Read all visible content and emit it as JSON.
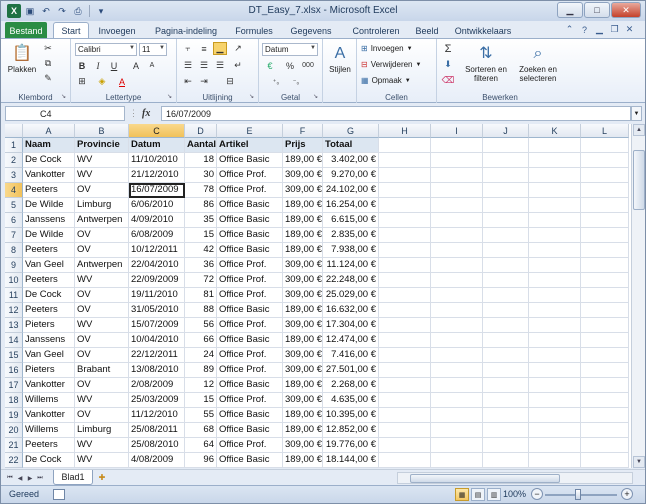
{
  "window": {
    "title": "DT_Easy_7.xlsx - Microsoft Excel",
    "app_icon": "X",
    "buttons": [
      "minimize",
      "maximize",
      "close"
    ]
  },
  "ribbon_tabs": [
    "Bestand",
    "Start",
    "Invoegen",
    "Pagina-indeling",
    "Formules",
    "Gegevens",
    "Controleren",
    "Beeld",
    "Ontwikkelaars"
  ],
  "ribbon": {
    "klembord": {
      "label": "Klembord",
      "plakken": "Plakken"
    },
    "lettertype": {
      "label": "Lettertype",
      "font": "Calibri",
      "size": "11"
    },
    "uitlijning": {
      "label": "Uitlijning"
    },
    "getal": {
      "label": "Getal",
      "format": "Datum"
    },
    "stijlen": {
      "label": "Stijlen"
    },
    "cellen": {
      "label": "Cellen",
      "invoegen": "Invoegen",
      "verwijderen": "Verwijderen",
      "opmaak": "Opmaak"
    },
    "bewerken": {
      "label": "Bewerken",
      "sorteren_1": "Sorteren en",
      "sorteren_2": "filteren",
      "zoeken_1": "Zoeken en",
      "zoeken_2": "selecteren"
    }
  },
  "formula_bar": {
    "name_box": "C4",
    "fx": "fx",
    "value": "16/07/2009"
  },
  "columns": [
    "A",
    "B",
    "C",
    "D",
    "E",
    "F",
    "G",
    "H",
    "I",
    "J",
    "K",
    "L"
  ],
  "selected_cell": {
    "col": "C",
    "row": 4
  },
  "table": {
    "headers": [
      "Naam",
      "Provincie",
      "Datum",
      "Aantal",
      "Artikel",
      "Prijs",
      "Totaal"
    ],
    "rows": [
      [
        "De Cock",
        "WV",
        "11/10/2010",
        "18",
        "Office Basic",
        "189,00 €",
        "3.402,00 €"
      ],
      [
        "Vankotter",
        "WV",
        "21/12/2010",
        "30",
        "Office Prof.",
        "309,00 €",
        "9.270,00 €"
      ],
      [
        "Peeters",
        "OV",
        "16/07/2009",
        "78",
        "Office Prof.",
        "309,00 €",
        "24.102,00 €"
      ],
      [
        "De Wilde",
        "Limburg",
        "6/06/2010",
        "86",
        "Office Basic",
        "189,00 €",
        "16.254,00 €"
      ],
      [
        "Janssens",
        "Antwerpen",
        "4/09/2010",
        "35",
        "Office Basic",
        "189,00 €",
        "6.615,00 €"
      ],
      [
        "De Wilde",
        "OV",
        "6/08/2009",
        "15",
        "Office Basic",
        "189,00 €",
        "2.835,00 €"
      ],
      [
        "Peeters",
        "OV",
        "10/12/2011",
        "42",
        "Office Basic",
        "189,00 €",
        "7.938,00 €"
      ],
      [
        "Van Geel",
        "Antwerpen",
        "22/04/2010",
        "36",
        "Office Prof.",
        "309,00 €",
        "11.124,00 €"
      ],
      [
        "Peeters",
        "WV",
        "22/09/2009",
        "72",
        "Office Prof.",
        "309,00 €",
        "22.248,00 €"
      ],
      [
        "De Cock",
        "OV",
        "19/11/2010",
        "81",
        "Office Prof.",
        "309,00 €",
        "25.029,00 €"
      ],
      [
        "Peeters",
        "OV",
        "31/05/2010",
        "88",
        "Office Basic",
        "189,00 €",
        "16.632,00 €"
      ],
      [
        "Pieters",
        "WV",
        "15/07/2009",
        "56",
        "Office Prof.",
        "309,00 €",
        "17.304,00 €"
      ],
      [
        "Janssens",
        "OV",
        "10/04/2010",
        "66",
        "Office Basic",
        "189,00 €",
        "12.474,00 €"
      ],
      [
        "Van Geel",
        "OV",
        "22/12/2011",
        "24",
        "Office Prof.",
        "309,00 €",
        "7.416,00 €"
      ],
      [
        "Pieters",
        "Brabant",
        "13/08/2010",
        "89",
        "Office Prof.",
        "309,00 €",
        "27.501,00 €"
      ],
      [
        "Vankotter",
        "OV",
        "2/08/2009",
        "12",
        "Office Basic",
        "189,00 €",
        "2.268,00 €"
      ],
      [
        "Willems",
        "WV",
        "25/03/2009",
        "15",
        "Office Prof.",
        "309,00 €",
        "4.635,00 €"
      ],
      [
        "Vankotter",
        "OV",
        "11/12/2010",
        "55",
        "Office Basic",
        "189,00 €",
        "10.395,00 €"
      ],
      [
        "Willems",
        "Limburg",
        "25/08/2011",
        "68",
        "Office Basic",
        "189,00 €",
        "12.852,00 €"
      ],
      [
        "Peeters",
        "WV",
        "25/08/2010",
        "64",
        "Office Prof.",
        "309,00 €",
        "19.776,00 €"
      ],
      [
        "De Cock",
        "WV",
        "4/08/2009",
        "96",
        "Office Basic",
        "189,00 €",
        "18.144,00 €"
      ]
    ]
  },
  "sheet_tab": "Blad1",
  "status": {
    "text": "Gereed",
    "zoom": "100%"
  }
}
